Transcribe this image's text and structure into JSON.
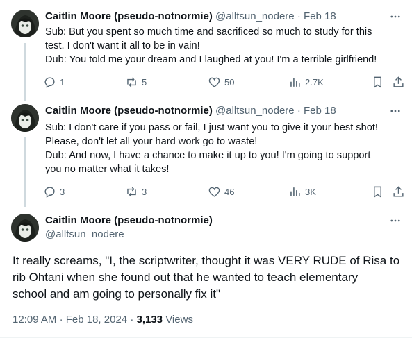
{
  "tweets": [
    {
      "author": {
        "name": "Caitlin Moore (pseudo-notnormie)",
        "handle": "@alltsun_nodere"
      },
      "separator": "·",
      "date": "Feb 18",
      "lines": [
        "Sub: But you spent so much time and sacrificed so much to study for this",
        "test. I don't want it all to be in vain!",
        "Dub: You told me your dream and I laughed at you! I'm a terrible girlfriend!"
      ],
      "stats": {
        "replies": "1",
        "reposts": "5",
        "likes": "50",
        "views": "2.7K"
      }
    },
    {
      "author": {
        "name": "Caitlin Moore (pseudo-notnormie)",
        "handle": "@alltsun_nodere"
      },
      "separator": "·",
      "date": "Feb 18",
      "lines": [
        "Sub: I don't care if you pass or fail, I just want you to give it your best shot!",
        "Please, don't let all your hard work go to waste!",
        "Dub: And now, I have a chance to make it up to you! I'm going to support",
        "you no matter what it takes!"
      ],
      "stats": {
        "replies": "3",
        "reposts": "3",
        "likes": "46",
        "views": "3K"
      }
    }
  ],
  "main": {
    "author": {
      "name": "Caitlin Moore (pseudo-notnormie)",
      "handle": "@alltsun_nodere"
    },
    "lines": [
      "It really screams, \"I, the scriptwriter, thought it was VERY RUDE of Risa to",
      "rib Ohtani when she found out that he wanted to teach elementary",
      "school and am going to personally fix it\""
    ],
    "time": "12:09 AM",
    "separator": "·",
    "date": "Feb 18, 2024",
    "separator2": "·",
    "views_count": "3,133",
    "views_label": "Views"
  },
  "icons": {
    "more": "more-horizontal-icon",
    "reply": "speech-bubble-icon",
    "repost": "repost-arrows-icon",
    "like": "heart-icon",
    "views": "bar-chart-icon",
    "bookmark": "bookmark-icon",
    "share": "share-upload-icon"
  }
}
